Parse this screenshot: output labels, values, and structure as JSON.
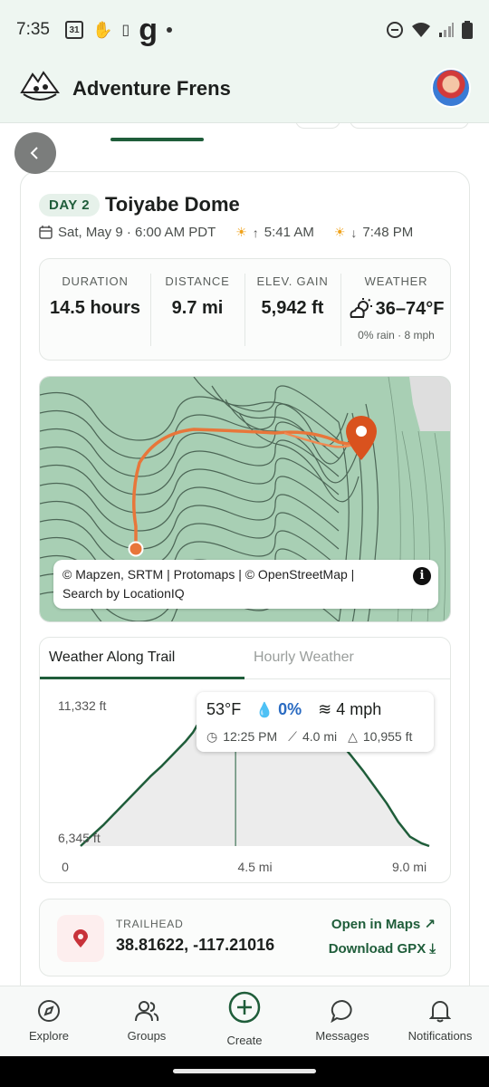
{
  "status_bar": {
    "time": "7:35",
    "calendar_badge": "31"
  },
  "header": {
    "app_title": "Adventure Frens"
  },
  "trip": {
    "day_badge": "DAY 2",
    "place": "Toiyabe Dome",
    "date": "Sat, May 9 · 6:00 AM PDT",
    "sunrise": "5:41 AM",
    "sunset": "7:48 PM"
  },
  "stats": {
    "duration_label": "DURATION",
    "duration_value": "14.5 hours",
    "distance_label": "DISTANCE",
    "distance_value": "9.7 mi",
    "elev_label": "ELEV. GAIN",
    "elev_value": "5,942 ft",
    "weather_label": "WEATHER",
    "weather_value": "36–74°F",
    "weather_sub": "0% rain · 8 mph"
  },
  "map": {
    "attribution_line1": "© Mapzen, SRTM | Protomaps | © OpenStreetMap |",
    "attribution_line2": "Search by LocationIQ",
    "info_symbol": "i"
  },
  "weather_panel": {
    "tab_active": "Weather Along Trail",
    "tab_inactive": "Hourly Weather",
    "tooltip": {
      "temp": "53°F",
      "rain": "0%",
      "wind": "4 mph",
      "time": "12:25 PM",
      "distance": "4.0 mi",
      "elevation": "10,955 ft"
    }
  },
  "chart_data": {
    "type": "area",
    "title": "",
    "xlabel": "",
    "ylabel": "",
    "x_unit": "mi",
    "y_unit": "ft",
    "x_ticks": [
      "0",
      "4.5 mi",
      "9.0 mi"
    ],
    "y_ticks": [
      "11,332 ft",
      "6,345 ft"
    ],
    "xlim": [
      0,
      9.0
    ],
    "ylim": [
      6345,
      11332
    ],
    "marker_x": 4.0,
    "series": [
      {
        "x": [
          0,
          0.3,
          0.6,
          0.9,
          1.2,
          1.5,
          1.8,
          2.1,
          2.4,
          2.7,
          2.9,
          3.0,
          3.2,
          3.4,
          3.6,
          3.8,
          4.0,
          4.2,
          4.4,
          4.6,
          4.8,
          5.0,
          5.2,
          5.4,
          5.6,
          5.8,
          6.0,
          6.2,
          6.4,
          6.6,
          6.8,
          7.0,
          7.3,
          7.6,
          7.9,
          8.2,
          8.5,
          8.8,
          9.0
        ],
        "values": [
          6345,
          6750,
          7150,
          7600,
          8050,
          8500,
          8950,
          9350,
          9800,
          10250,
          10600,
          10850,
          11050,
          11180,
          11250,
          11250,
          11332,
          11330,
          11320,
          11300,
          11280,
          11250,
          11200,
          11150,
          11100,
          11000,
          10850,
          10650,
          10500,
          10300,
          10050,
          9700,
          9150,
          8550,
          7950,
          7250,
          6700,
          6450,
          6345
        ]
      }
    ]
  },
  "trailhead": {
    "label": "TRAILHEAD",
    "coords": "38.81622, -117.21016",
    "open_maps": "Open in Maps ↗",
    "download_gpx": "Download GPX ⤓"
  },
  "bottom_nav": {
    "explore": "Explore",
    "groups": "Groups",
    "create": "Create",
    "messages": "Messages",
    "notifications": "Notifications"
  },
  "colors": {
    "accent": "#1f5d3a",
    "map_base": "#a8cfb4",
    "trail": "#e8763a",
    "pin": "#d9521e",
    "rain": "#2a6bc2"
  },
  "icons": {
    "back": "chevron-left-icon",
    "calendar": "calendar-icon",
    "sunrise": "sunrise-icon",
    "sunset": "sunset-icon",
    "weather": "partly-cloudy-icon",
    "location": "map-pin-icon"
  }
}
